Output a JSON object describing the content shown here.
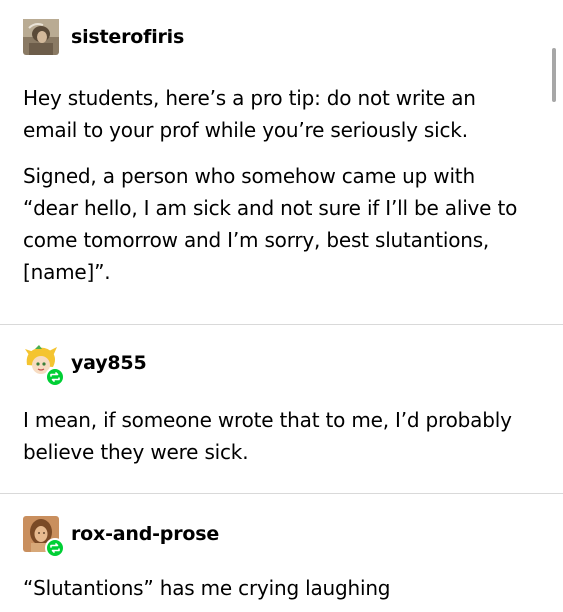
{
  "posts": [
    {
      "username": "sisterofiris",
      "paragraphs": [
        "Hey students, here’s a pro tip: do not write an email to your prof while you’re seriously sick.",
        "Signed, a person who somehow came up with “dear hello, I am sick and not sure if I’ll be alive to come tomorrow and I’m sorry, best slutantions, [name]”."
      ]
    },
    {
      "username": "yay855",
      "paragraphs": [
        "I mean, if someone wrote that to me, I’d probably believe they were sick."
      ]
    },
    {
      "username": "rox-and-prose",
      "paragraphs": [
        "“Slutantions” has me crying laughing"
      ]
    }
  ],
  "icons": {
    "reblog": "reblog-icon"
  },
  "colors": {
    "reblog_badge": "#00cf35",
    "divider": "#d9d9d9",
    "text": "#000000"
  }
}
